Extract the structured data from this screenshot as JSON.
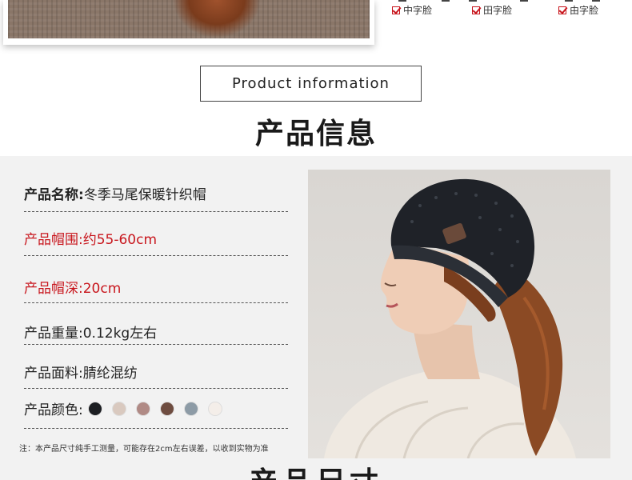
{
  "face_types": [
    "中字脸",
    "田字脸",
    "由字脸"
  ],
  "header": {
    "english_title": "Product information",
    "chinese_title": "产品信息"
  },
  "info": {
    "name_label": "产品名称:",
    "name_value": "冬季马尾保暖针织帽",
    "circumference": "产品帽围:约55-60cm",
    "depth": "产品帽深:20cm",
    "weight": "产品重量:0.12kg左右",
    "material_label": "产品面料:",
    "material_value": "腈纶混纺",
    "color_label": "产品颜色:",
    "colors": [
      "#1c1e22",
      "#d9c9bf",
      "#b08a85",
      "#6e4c40",
      "#8d9ba6",
      "#f4eee9"
    ],
    "note": "注：本产品尺寸纯手工测量，可能存在2cm左右误差，以收到实物为准"
  },
  "bottom_title": "产品尺寸"
}
